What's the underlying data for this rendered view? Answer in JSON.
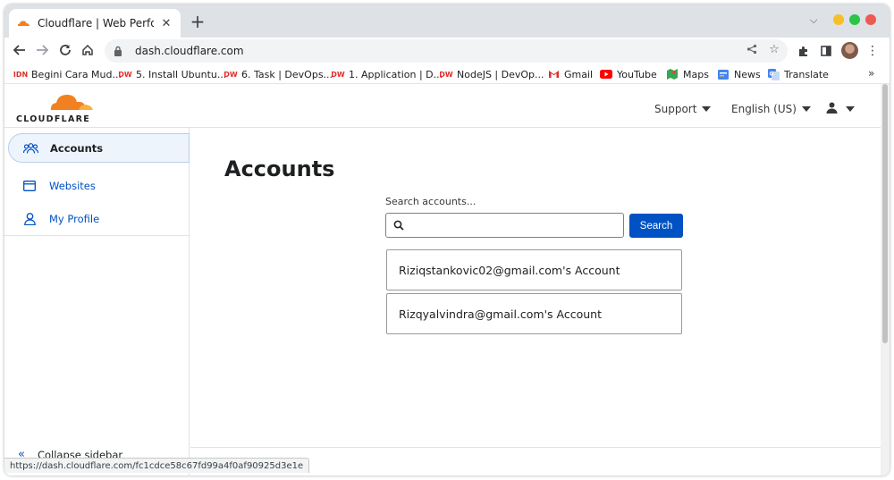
{
  "browser": {
    "tab_title": "Cloudflare | Web Performance",
    "tab_close": "✕",
    "new_tab": "+",
    "tab_menu": "⌵",
    "url": "dash.cloudflare.com",
    "status_url": "https://dash.cloudflare.com/fc1cdce58c67fd99a4f0af90925d3e1e",
    "bookmarks": [
      {
        "label": "Begini Cara Mud...",
        "icon": "idn-icon"
      },
      {
        "label": "5. Install Ubuntu...",
        "icon": "dw-icon"
      },
      {
        "label": "6. Task | DevOps...",
        "icon": "dw-icon"
      },
      {
        "label": "1. Application | D...",
        "icon": "dw-icon"
      },
      {
        "label": "NodeJS | DevOp...",
        "icon": "dw-icon"
      },
      {
        "label": "Gmail",
        "icon": "gmail-icon"
      },
      {
        "label": "YouTube",
        "icon": "youtube-icon"
      },
      {
        "label": "Maps",
        "icon": "maps-icon"
      },
      {
        "label": "News",
        "icon": "news-icon"
      },
      {
        "label": "Translate",
        "icon": "translate-icon"
      }
    ],
    "bookmarks_more": "»"
  },
  "header": {
    "logo_text": "CLOUDFLARE",
    "support_label": "Support",
    "language_label": "English (US)"
  },
  "sidebar": {
    "items": [
      {
        "label": "Accounts",
        "icon": "accounts-icon"
      },
      {
        "label": "Websites",
        "icon": "websites-icon"
      },
      {
        "label": "My Profile",
        "icon": "profile-icon"
      }
    ],
    "collapse_label": "Collapse sidebar"
  },
  "main": {
    "title": "Accounts",
    "search_label": "Search accounts...",
    "search_placeholder": "",
    "search_button": "Search",
    "accounts": [
      "Riziqstankovic02@gmail.com's Account",
      "Rizqyalvindra@gmail.com's Account"
    ]
  },
  "colors": {
    "accent": "#0051c3",
    "cloudflare_orange": "#f38020",
    "cloudflare_light_orange": "#faae40"
  }
}
